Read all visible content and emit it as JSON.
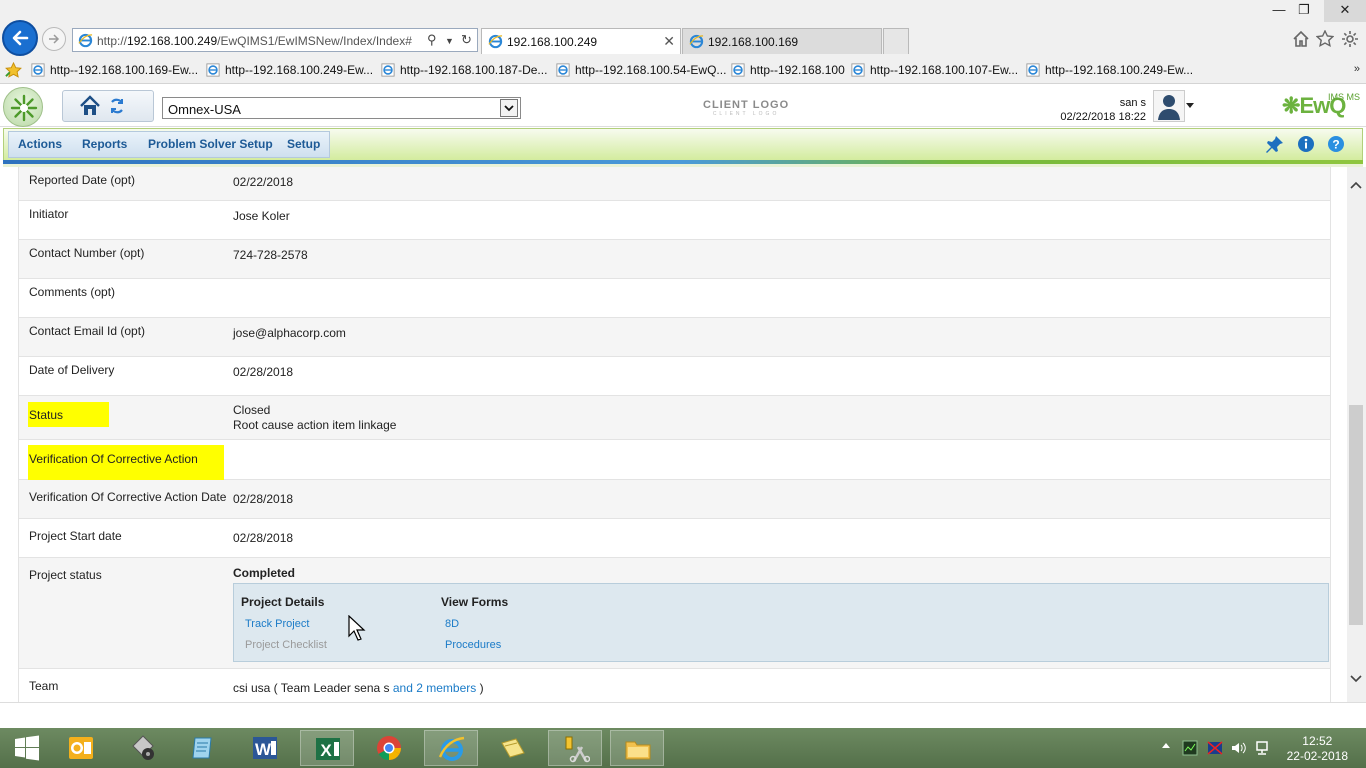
{
  "browser": {
    "address": {
      "prefix": "http://",
      "host": "192.168.100.249",
      "path": "/EwQIMS1/EwIMSNew/Index/Index#"
    },
    "tabs": [
      {
        "label": "192.168.100.249",
        "active": true
      },
      {
        "label": "192.168.100.169",
        "active": false
      }
    ],
    "favorites": [
      "http--192.168.100.169-Ew...",
      "http--192.168.100.249-Ew...",
      "http--192.168.100.187-De...",
      "http--192.168.100.54-EwQ...",
      "http--192.168.100",
      "http--192.168.100.107-Ew...",
      "http--192.168.100.249-Ew..."
    ],
    "favorites_more": "»"
  },
  "header": {
    "site_selected": "Omnex-USA",
    "client_logo": "CLIENT LOGO",
    "client_logo_sub": "CLIENT LOGO",
    "user_name": "san s",
    "user_datetime": "02/22/2018 18:22",
    "brand": "EwQ",
    "brand_sub": "IMS MS"
  },
  "menu": {
    "items": [
      "Actions",
      "Reports",
      "Problem Solver Setup",
      "Setup"
    ]
  },
  "details": {
    "reported_date_label": "Reported Date (opt)",
    "reported_date": "02/22/2018",
    "initiator_label": "Initiator",
    "initiator": "Jose Koler",
    "contact_number_label": "Contact Number (opt)",
    "contact_number": "724-728-2578",
    "comments_label": "Comments (opt)",
    "comments": "",
    "contact_email_label": "Contact Email Id (opt)",
    "contact_email": "jose@alphacorp.com",
    "delivery_label": "Date of Delivery",
    "delivery": "02/28/2018",
    "status_label": "Status",
    "status": "Closed",
    "status_link": "Root cause action item linkage",
    "verification_label": "Verification Of Corrective Action",
    "verification_date_label": "Verification Of Corrective Action Date",
    "verification_date": "02/28/2018",
    "project_start_label": "Project Start date",
    "project_start": "02/28/2018",
    "project_status_label": "Project status",
    "project_status": "Completed",
    "project_details_header": "Project Details",
    "track_project": "Track Project",
    "project_checklist": "Project Checklist",
    "view_forms_header": "View Forms",
    "form_8d": "8D",
    "procedures": "Procedures",
    "team_label": "Team",
    "team_prefix": "csi usa ( Team Leader sena s",
    "team_members_link": "and 2 members",
    "team_suffix": ")"
  },
  "taskbar": {
    "time": "12:52",
    "date": "22-02-2018"
  },
  "colors": {
    "highlight": "#ffff00",
    "link": "#1b7bc7",
    "completed": "#4caf28",
    "menu_text": "#1d5a96"
  }
}
